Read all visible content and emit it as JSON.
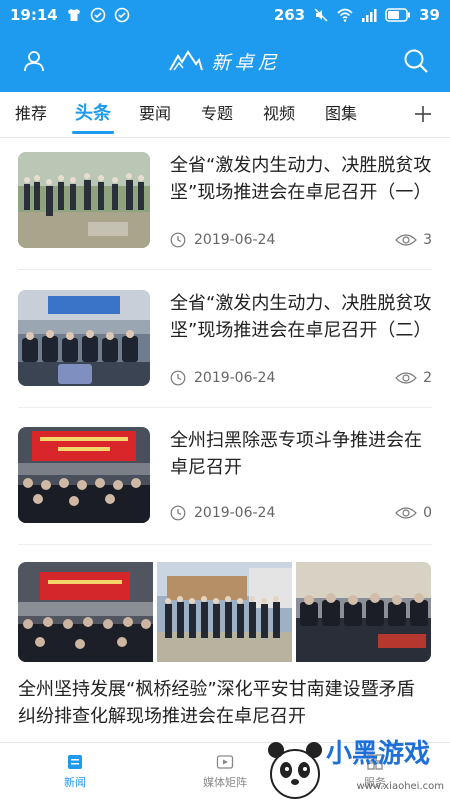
{
  "status_bar": {
    "time": "19:14",
    "speed": "263",
    "battery": "39"
  },
  "header": {
    "logo_text": "新卓尼"
  },
  "tabs": [
    {
      "label": "推荐"
    },
    {
      "label": "头条"
    },
    {
      "label": "要闻"
    },
    {
      "label": "专题"
    },
    {
      "label": "视频"
    },
    {
      "label": "图集"
    }
  ],
  "articles": [
    {
      "title": "全省“激发内生动力、决胜脱贫攻坚”现场推进会在卓尼召开（一）",
      "date": "2019-06-24",
      "views": "3"
    },
    {
      "title": "全省“激发内生动力、决胜脱贫攻坚”现场推进会在卓尼召开（二）",
      "date": "2019-06-24",
      "views": "2"
    },
    {
      "title": "全州扫黑除恶专项斗争推进会在卓尼召开",
      "date": "2019-06-24",
      "views": "0"
    }
  ],
  "multi_article": {
    "title": "全州坚持发展“枫桥经验”深化平安甘南建设暨矛盾纠纷排查化解现场推进会在卓尼召开"
  },
  "bottom_nav": [
    {
      "label": "新闻"
    },
    {
      "label": "媒体矩阵"
    },
    {
      "label": "服务"
    }
  ],
  "watermark": {
    "text": "小黑游戏",
    "sub": "www.xiaohei.com"
  },
  "colors": {
    "accent": "#1e9bef"
  }
}
